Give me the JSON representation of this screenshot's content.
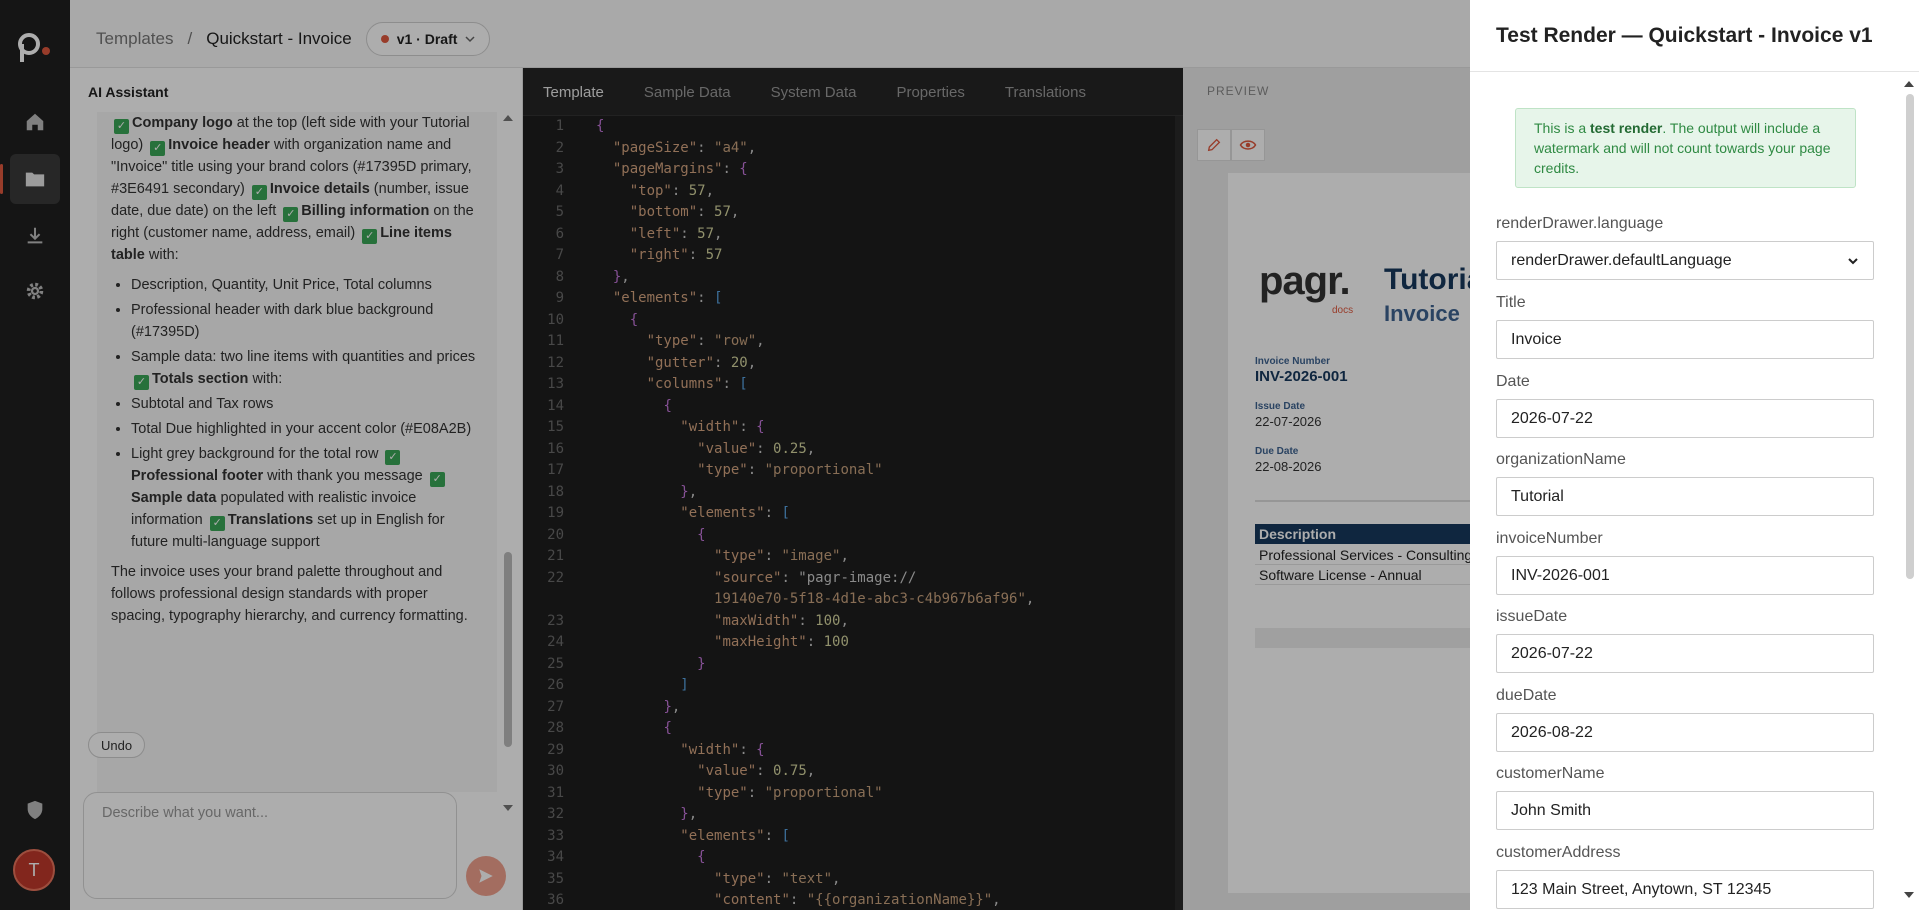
{
  "nav": {
    "items": [
      "home-icon",
      "folder-icon",
      "download-icon",
      "gear-icon",
      "shield-icon"
    ],
    "avatar_initial": "T"
  },
  "header": {
    "crumb_root": "Templates",
    "separator": "/",
    "crumb_current": "Quickstart - Invoice",
    "version_label": "v1 · Draft"
  },
  "assistant": {
    "title": "AI Assistant",
    "p1_parts": {
      "a": "Company logo",
      "a_rest": " at the top (left side with your Tutorial logo) ",
      "b": "Invoice header",
      "b_rest": " with organization name and \"Invoice\" title using your brand colors (#17395D primary, #3E6491 secondary) ",
      "c": "Invoice details",
      "c_rest": " (number, issue date, due date) on the left ",
      "d": "Billing information",
      "d_rest": " on the right (customer name, address, email) ",
      "e": "Line items table",
      "e_rest": " with:"
    },
    "list1": [
      "Description, Quantity, Unit Price, Total columns",
      "Professional header with dark blue background (#17395D)"
    ],
    "list1_c": {
      "pre": "Sample data: two line items with quantities and prices ",
      "bold": "Totals section",
      "post": " with:"
    },
    "list1_d": "Subtotal and Tax rows",
    "list1_e": "Total Due highlighted in your accent color (#E08A2B)",
    "list1_f": {
      "pre": "Light grey background for the total row ",
      "b1": "Professional footer",
      "m1": " with thank you message ",
      "b2": "Sample data",
      "m2": " populated with realistic invoice information ",
      "b3": "Translations",
      "m3": " set up in English for future multi-language support"
    },
    "closing": "The invoice uses your brand palette throughout and follows professional design standards with proper spacing, typography hierarchy, and currency formatting.",
    "undo_label": "Undo",
    "composer_placeholder": "Describe what you want..."
  },
  "editor": {
    "tabs": [
      "Template",
      "Sample Data",
      "System Data",
      "Properties",
      "Translations"
    ],
    "active_tab": "Template"
  },
  "preview": {
    "label": "PREVIEW",
    "logo": "pagr.",
    "logo_sub": "docs",
    "org_title": "Tutorial",
    "invoice_title": "Invoice",
    "invoice_number_label": "Invoice Number",
    "invoice_number": "INV-2026-001",
    "issue_date_label": "Issue Date",
    "issue_date": "22-07-2026",
    "due_date_label": "Due Date",
    "due_date": "22-08-2026",
    "table_header": "Description",
    "rows": [
      "Professional Services - Consulting",
      "Software License - Annual"
    ]
  },
  "drawer": {
    "title": "Test Render — Quickstart - Invoice v1",
    "notice_pre": "This is a ",
    "notice_bold": "test render",
    "notice_post": ". The output will include a watermark and will not count towards your page credits.",
    "language_label": "renderDrawer.language",
    "language_value": "renderDrawer.defaultLanguage",
    "fields": [
      {
        "label": "Title",
        "value": "Invoice"
      },
      {
        "label": "Date",
        "value": "2026-07-22"
      },
      {
        "label": "organizationName",
        "value": "Tutorial"
      },
      {
        "label": "invoiceNumber",
        "value": "INV-2026-001"
      },
      {
        "label": "issueDate",
        "value": "2026-07-22"
      },
      {
        "label": "dueDate",
        "value": "2026-08-22"
      },
      {
        "label": "customerName",
        "value": "John Smith"
      },
      {
        "label": "customerAddress",
        "value": "123 Main Street, Anytown, ST 12345"
      }
    ]
  },
  "colors": {
    "brand_primary": "#17395D",
    "brand_secondary": "#3E6491",
    "accent": "#E08A2B",
    "logo_accent": "#e0593f",
    "notice_bg": "#e7f5ea"
  },
  "code_lines": [
    "{",
    "  \"pageSize\": \"a4\",",
    "  \"pageMargins\": {",
    "    \"top\": 57,",
    "    \"bottom\": 57,",
    "    \"left\": 57,",
    "    \"right\": 57",
    "  },",
    "  \"elements\": [",
    "    {",
    "      \"type\": \"row\",",
    "      \"gutter\": 20,",
    "      \"columns\": [",
    "        {",
    "          \"width\": {",
    "            \"value\": 0.25,",
    "            \"type\": \"proportional\"",
    "          },",
    "          \"elements\": [",
    "            {",
    "              \"type\": \"image\",",
    "              \"source\": \"pagr-image://",
    "              19140e70-5f18-4d1e-abc3-c4b967b6af96\",",
    "              \"maxWidth\": 100,",
    "              \"maxHeight\": 100",
    "            }",
    "          ]",
    "        },",
    "        {",
    "          \"width\": {",
    "            \"value\": 0.75,",
    "            \"type\": \"proportional\"",
    "          },",
    "          \"elements\": [",
    "            {",
    "              \"type\": \"text\",",
    "              \"content\": \"{{organizationName}}\","
  ],
  "line_numbers": [
    "1",
    "2",
    "3",
    "4",
    "5",
    "6",
    "7",
    "8",
    "9",
    "10",
    "11",
    "12",
    "13",
    "14",
    "15",
    "16",
    "17",
    "18",
    "19",
    "20",
    "21",
    "22",
    "",
    "23",
    "24",
    "25",
    "26",
    "27",
    "28",
    "29",
    "30",
    "31",
    "32",
    "33",
    "34",
    "35",
    "36"
  ]
}
